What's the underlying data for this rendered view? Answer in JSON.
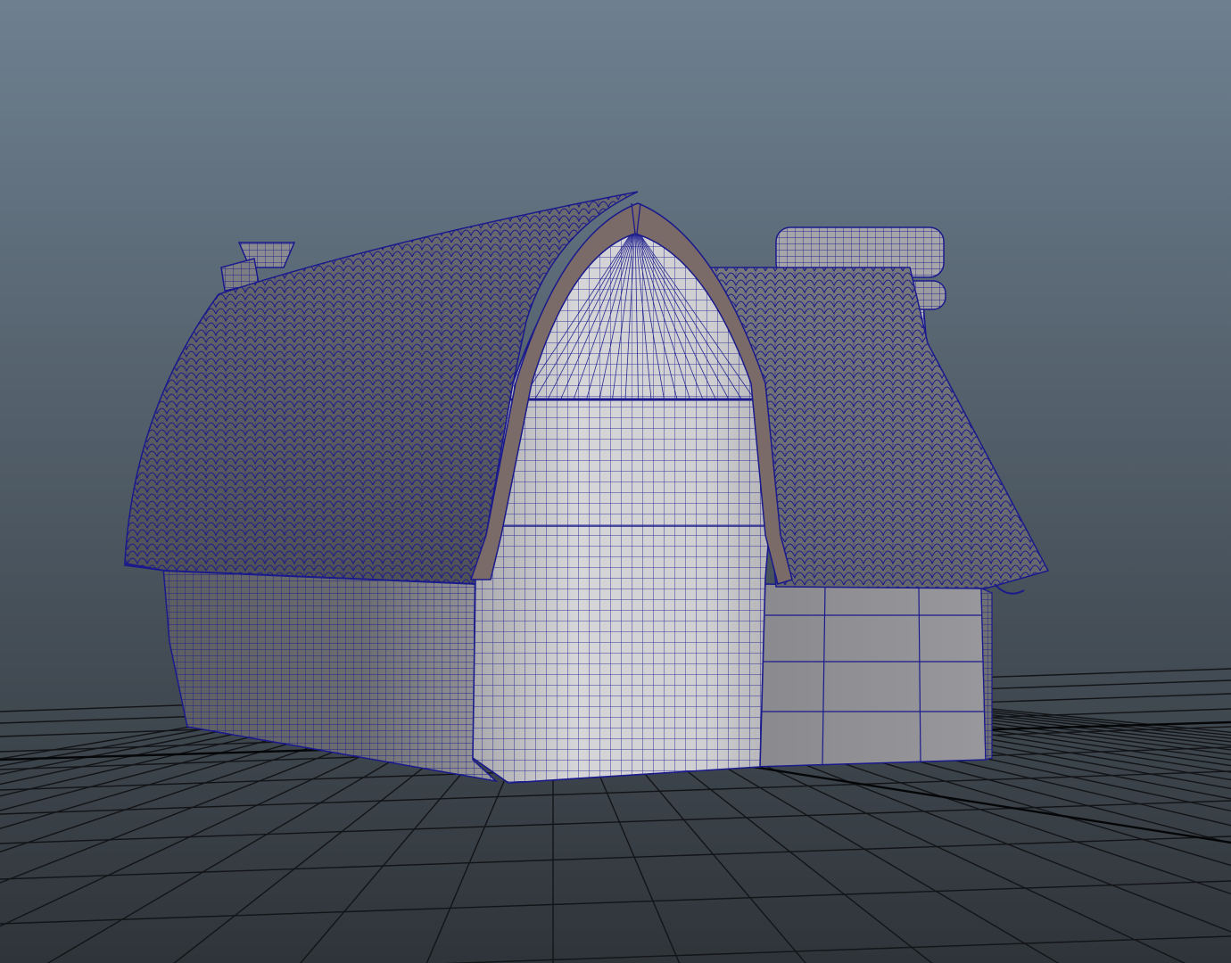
{
  "viewport": {
    "background_top": "#6e8090",
    "background_bottom": "#2f3439",
    "grid_color": "#121417",
    "axis_color": "#050607",
    "wireframe_color": "#1a1a8c",
    "shade_light": "#c9c9cc",
    "shade_mid": "#8f8f93",
    "shade_dark": "#55565a",
    "roof_trim_color": "#7a6a68",
    "display_mode": "wireframe-on-shaded",
    "grid_visible": true
  }
}
